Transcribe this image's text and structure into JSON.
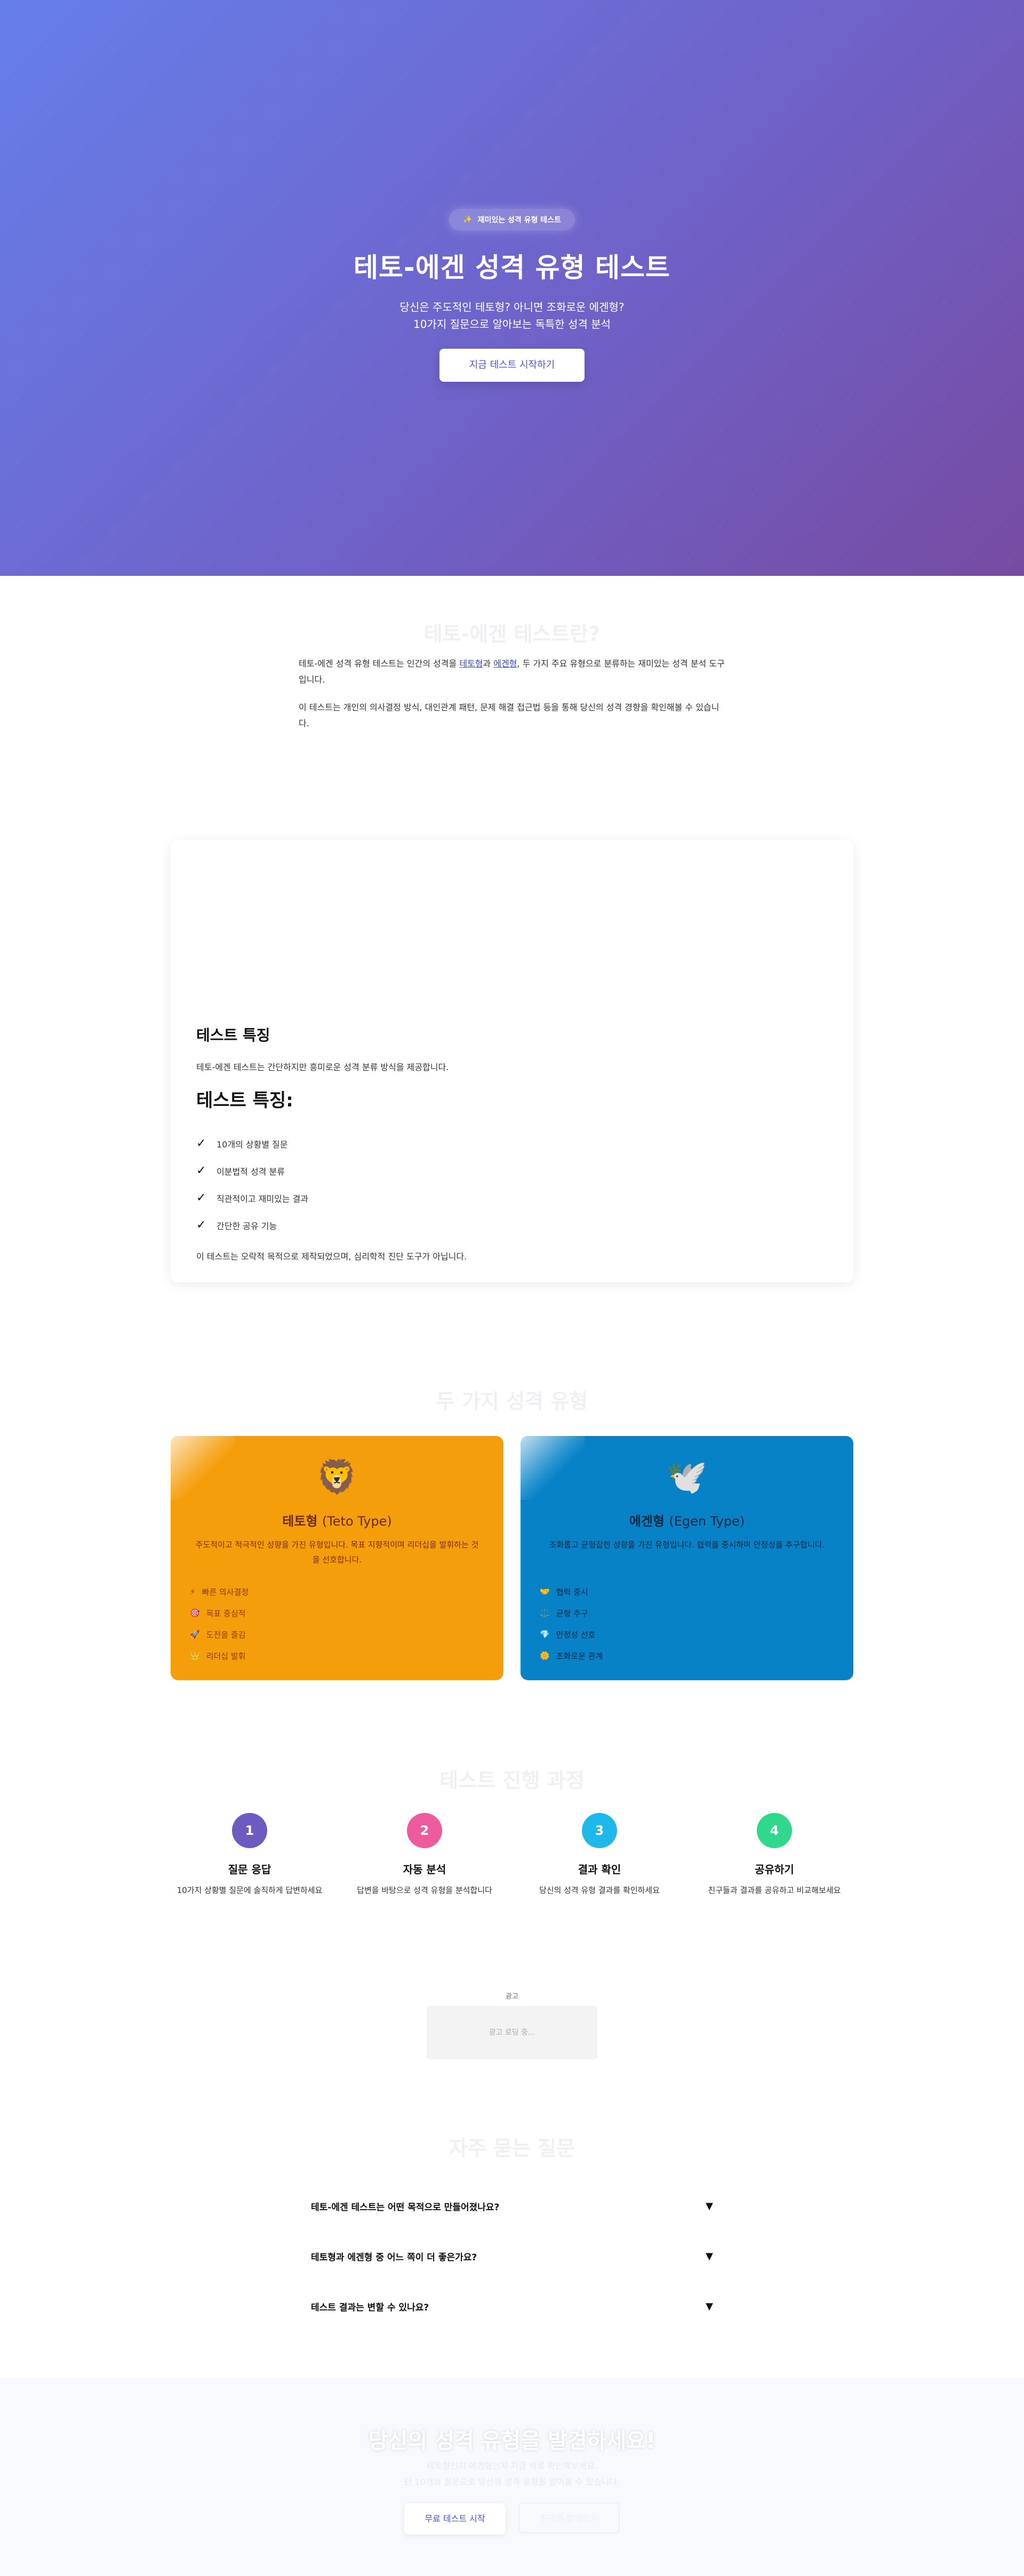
{
  "hero": {
    "badge_icon": "sparkle-icon",
    "badge": "재미있는 성격 유형 테스트",
    "title": "테토-에겐 성격 유형 테스트",
    "subtitle_line1": "당신은 주도적인 테토형? 아니면 조화로운 에겐형?",
    "subtitle_line2": "10가지 질문으로 알아보는 독특한 성격 분석",
    "cta": "지금 테스트 시작하기"
  },
  "about": {
    "title": "테토-에겐 테스트란?",
    "p1_a": "테토-에겐 성격 유형 테스트는 인간의 성격을 ",
    "p1_link1": "테토형",
    "p1_b": "과 ",
    "p1_link2": "에겐형",
    "p1_c": ", 두 가지 주요 유형으로 분류하는 재미있는 성격 분석 도구입니다.",
    "p2": "이 테스트는 개인의 의사결정 방식, 대인관계 패턴, 문제 해결 접근법 등을 통해 당신의 성격 경향을 확인해볼 수 있습니다."
  },
  "features": {
    "heading": "테스트 특징",
    "desc": "테토-에겐 테스트는 간단하지만 흥미로운 성격 분류 방식을 제공합니다.",
    "subheading": "테스트 특징:",
    "items": [
      "10개의 상황별 질문",
      "이분법적 성격 분류",
      "직관적이고 재미있는 결과",
      "간단한 공유 기능"
    ],
    "note": "이 테스트는 오락적 목적으로 제작되었으며, 심리학적 진단 도구가 아닙니다."
  },
  "types": {
    "title": "두 가지 성격 유형",
    "teto": {
      "emoji": "🦁",
      "name": "테토형",
      "name_en": "(Teto Type)",
      "desc": "주도적이고 적극적인 성향을 가진 유형입니다. 목표 지향적이며 리더십을 발휘하는 것을 선호합니다.",
      "traits": [
        {
          "icon": "⚡",
          "label": "빠른 의사결정"
        },
        {
          "icon": "🎯",
          "label": "목표 중심적"
        },
        {
          "icon": "🚀",
          "label": "도전을 즐김"
        },
        {
          "icon": "👑",
          "label": "리더십 발휘"
        }
      ]
    },
    "egen": {
      "emoji": "🕊️",
      "name": "에겐형",
      "name_en": "(Egen Type)",
      "desc": "조화롭고 균형잡힌 성향을 가진 유형입니다. 협력을 중시하며 안정성을 추구합니다.",
      "traits": [
        {
          "icon": "🤝",
          "label": "협력 중시"
        },
        {
          "icon": "⚖️",
          "label": "균형 추구"
        },
        {
          "icon": "💎",
          "label": "안정성 선호"
        },
        {
          "icon": "🌼",
          "label": "조화로운 관계"
        }
      ]
    }
  },
  "process": {
    "title": "테스트 진행 과정",
    "steps": [
      {
        "num": "1",
        "title": "질문 응답",
        "desc": "10가지 상황별 질문에 솔직하게 답변하세요",
        "color": "#6e5bc0"
      },
      {
        "num": "2",
        "title": "자동 분석",
        "desc": "답변을 바탕으로 성격 유형을 분석합니다",
        "color": "#ec5c9c"
      },
      {
        "num": "3",
        "title": "결과 확인",
        "desc": "당신의 성격 유형 결과를 확인하세요",
        "color": "#1fb8ea"
      },
      {
        "num": "4",
        "title": "공유하기",
        "desc": "친구들과 결과를 공유하고 비교해보세요",
        "color": "#2fd88a"
      }
    ]
  },
  "ad": {
    "label": "광고",
    "placeholder": "광고 로딩 중..."
  },
  "faq": {
    "title": "자주 묻는 질문",
    "items": [
      "테토-에겐 테스트는 어떤 목적으로 만들어졌나요?",
      "테토형과 에겐형 중 어느 쪽이 더 좋은가요?",
      "테스트 결과는 변할 수 있나요?"
    ],
    "arrow": "▼"
  },
  "cta": {
    "title": "당신의 성격 유형을 발견하세요!",
    "sub_line1": "테토형인지 에겐형인지 지금 바로 확인해보세요.",
    "sub_line2": "단 10개의 질문으로 당신의 성격 유형을 알아볼 수 있습니다.",
    "primary": "무료 테스트 시작",
    "secondary": "친구와 함께하기"
  }
}
